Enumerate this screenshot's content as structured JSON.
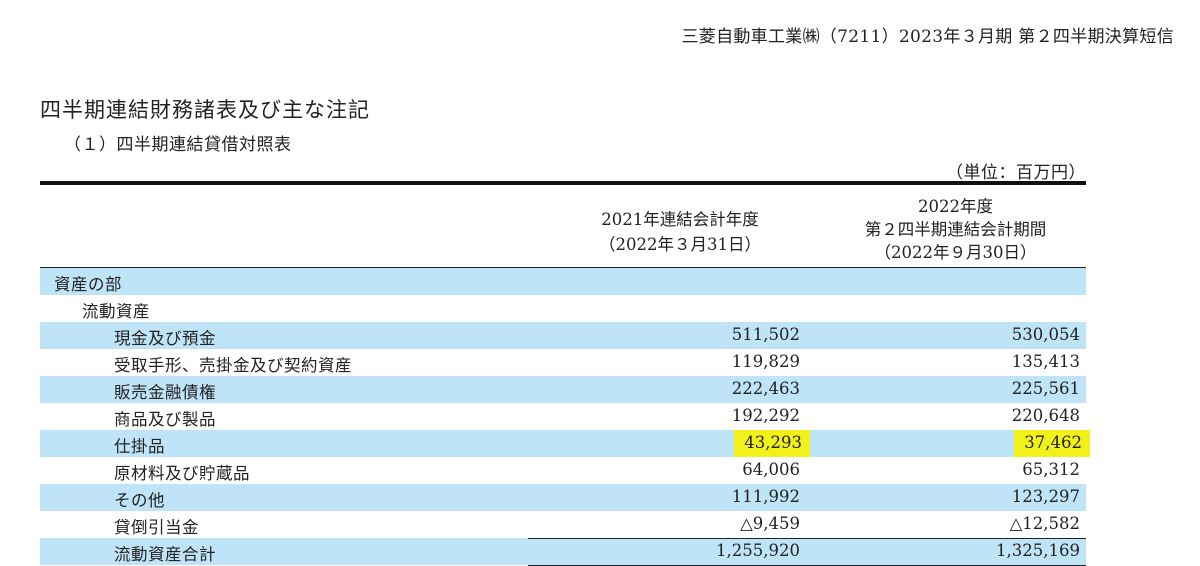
{
  "header": {
    "company_line": "三菱自動車工業㈱（7211）2023年３月期 第２四半期決算短信"
  },
  "section_title": "四半期連結財務諸表及び主な注記",
  "subsection_title": "（１）四半期連結貸借対照表",
  "unit": "（単位：百万円）",
  "columns": {
    "col1_line1": "2021年連結会計年度",
    "col1_line2": "（2022年３月31日）",
    "col2_line1": "2022年度",
    "col2_line2": "第２四半期連結会計期間",
    "col2_line3": "（2022年９月30日）"
  },
  "rows": [
    {
      "label": "資産の部",
      "v1": "",
      "v2": ""
    },
    {
      "label": "流動資産",
      "v1": "",
      "v2": ""
    },
    {
      "label": "現金及び預金",
      "v1": "511,502",
      "v2": "530,054"
    },
    {
      "label": "受取手形、売掛金及び契約資産",
      "v1": "119,829",
      "v2": "135,413"
    },
    {
      "label": "販売金融債権",
      "v1": "222,463",
      "v2": "225,561"
    },
    {
      "label": "商品及び製品",
      "v1": "192,292",
      "v2": "220,648"
    },
    {
      "label": "仕掛品",
      "v1": "43,293",
      "v2": "37,462"
    },
    {
      "label": "原材料及び貯蔵品",
      "v1": "64,006",
      "v2": "65,312"
    },
    {
      "label": "その他",
      "v1": "111,992",
      "v2": "123,297"
    },
    {
      "label": "貸倒引当金",
      "v1": "△9,459",
      "v2": "△12,582"
    },
    {
      "label": "流動資産合計",
      "v1": "1,255,920",
      "v2": "1,325,169"
    }
  ],
  "highlight_color": "#f2f21a",
  "row_shade_color": "#bfe4f8"
}
